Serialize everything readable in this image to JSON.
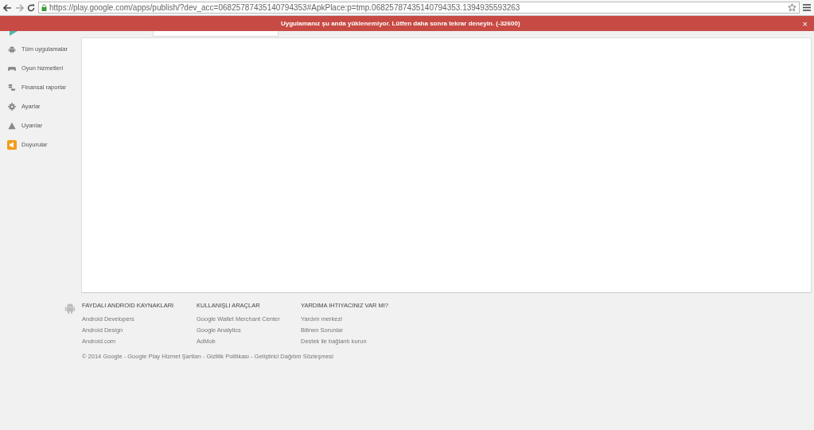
{
  "browser": {
    "url": "https://play.google.com/apps/publish/?dev_acc=06825787435140794353#ApkPlace:p=tmp.06825787435140794353.1394935593263"
  },
  "banner": {
    "message": "Uygulamanız şu anda yüklenemiyor. Lütfen daha sonra tekrar deneyin. (-32600)",
    "close": "×"
  },
  "sidebar": {
    "items": [
      {
        "label": "Tüm uygulamalar",
        "kind": "android"
      },
      {
        "label": "Oyun hizmetleri",
        "kind": "gamepad"
      },
      {
        "label": "Finansal raporlar",
        "kind": "coins"
      },
      {
        "label": "Ayarlar",
        "kind": "gear"
      },
      {
        "label": "Uyarılar",
        "kind": "warning"
      },
      {
        "label": "Duyurular",
        "kind": "megaphone"
      }
    ]
  },
  "footer": {
    "columns": [
      {
        "title": "FAYDALI ANDROID KAYNAKLARI",
        "links": [
          "Android Developers",
          "Android Design",
          "Android.com"
        ]
      },
      {
        "title": "KULLANIŞLI ARAÇLAR",
        "links": [
          "Google Wallet Merchant Center",
          "Google Analytics",
          "AdMob"
        ]
      },
      {
        "title": "YARDIMA IHTIYACINIZ VAR MI?",
        "links": [
          "Yardım merkezi",
          "Bilinen Sorunlar",
          "Destek ile bağlantı kurun"
        ]
      }
    ],
    "copyright": "© 2014 Google - Google Play Hizmet Şartları - Gizlilik Politikası - Geliştirici Dağıtım Sözleşmesi"
  }
}
